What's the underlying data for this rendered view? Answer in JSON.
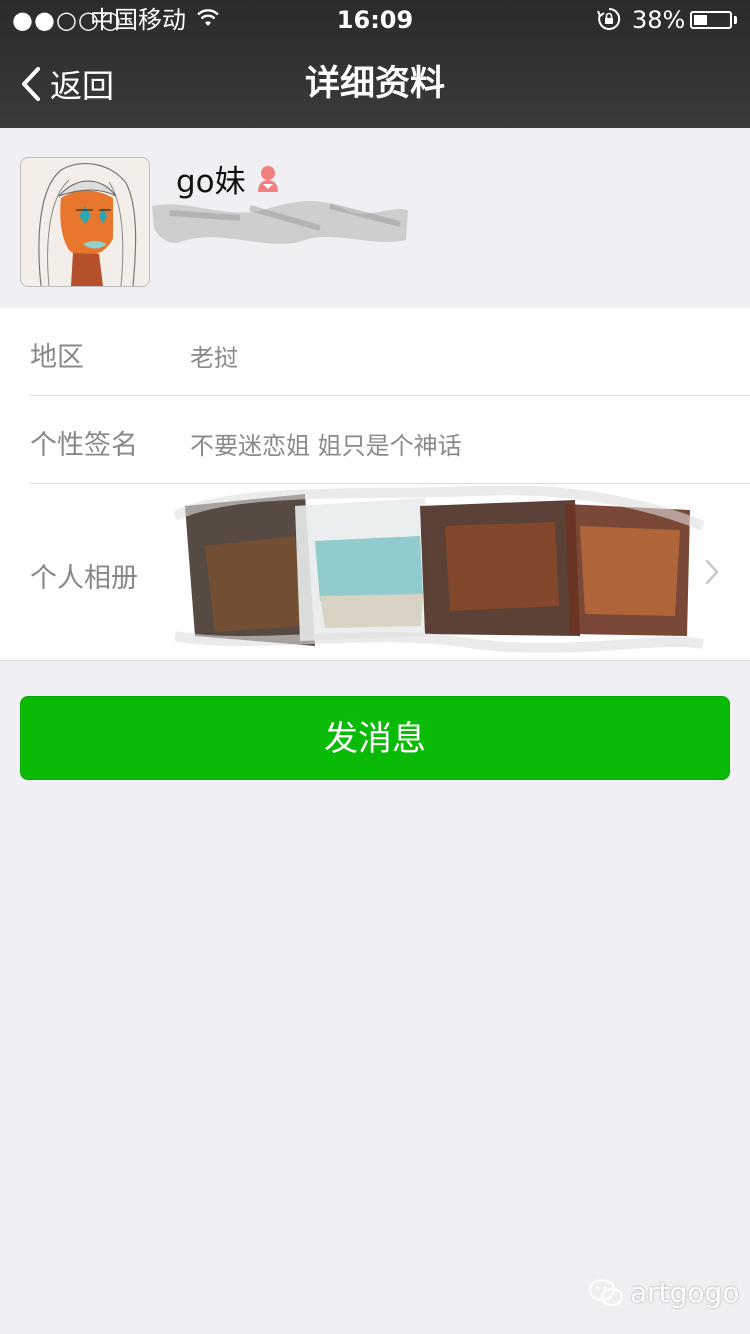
{
  "status_bar": {
    "signal": "●●○○○",
    "carrier": "中国移动",
    "time": "16:09",
    "battery_percent": "38%",
    "battery_level": 0.38
  },
  "nav": {
    "back_label": "返回",
    "title": "详细资料"
  },
  "profile": {
    "name": "go妹",
    "gender_icon": "female-icon"
  },
  "info": {
    "region_label": "地区",
    "region_value": "老挝",
    "signature_label": "个性签名",
    "signature_value": "不要迷恋姐 姐只是个神话",
    "album_label": "个人相册"
  },
  "action": {
    "send_label": "发消息"
  },
  "watermark": {
    "text": "artgogo"
  },
  "colors": {
    "nav_bg": "#2b2b2b",
    "page_bg": "#efeff4",
    "accent_green": "#09bb07",
    "gender_pink": "#f08080"
  }
}
